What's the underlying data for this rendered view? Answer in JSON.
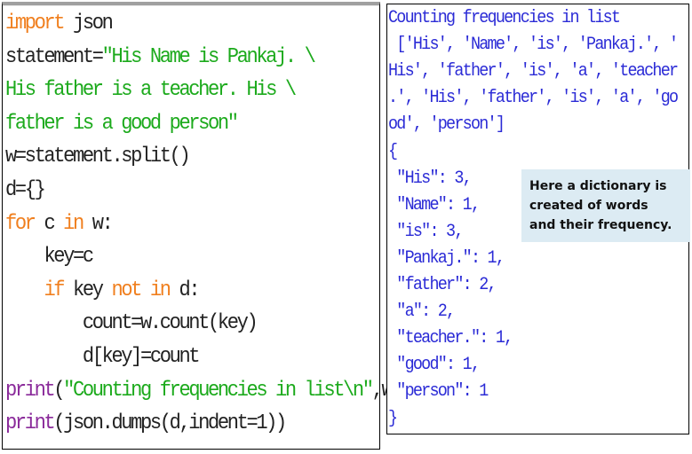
{
  "code_editor": {
    "language": "python",
    "lines": [
      {
        "indent": "",
        "tokens": [
          {
            "t": "import",
            "k": "kw"
          },
          {
            "t": " json",
            "k": "plain"
          }
        ]
      },
      {
        "indent": "",
        "tokens": [
          {
            "t": "statement=",
            "k": "plain"
          },
          {
            "t": "\"His Name is Pankaj. \\",
            "k": "str"
          }
        ]
      },
      {
        "indent": "",
        "tokens": [
          {
            "t": "His father is a teacher. His \\",
            "k": "str"
          }
        ]
      },
      {
        "indent": "",
        "tokens": [
          {
            "t": "father is a good person\"",
            "k": "str"
          }
        ]
      },
      {
        "indent": "",
        "tokens": [
          {
            "t": "w=statement.split()",
            "k": "plain"
          }
        ]
      },
      {
        "indent": "",
        "tokens": [
          {
            "t": "d={}",
            "k": "plain"
          }
        ]
      },
      {
        "indent": "",
        "tokens": [
          {
            "t": "for",
            "k": "kw"
          },
          {
            "t": " c ",
            "k": "plain"
          },
          {
            "t": "in",
            "k": "kw"
          },
          {
            "t": " w:",
            "k": "plain"
          }
        ]
      },
      {
        "indent": "    ",
        "tokens": [
          {
            "t": "key=c",
            "k": "plain"
          }
        ]
      },
      {
        "indent": "    ",
        "tokens": [
          {
            "t": "if",
            "k": "kw"
          },
          {
            "t": " key ",
            "k": "plain"
          },
          {
            "t": "not in",
            "k": "kw"
          },
          {
            "t": " d:",
            "k": "plain"
          }
        ]
      },
      {
        "indent": "        ",
        "tokens": [
          {
            "t": "count=w.count(key)",
            "k": "plain"
          }
        ]
      },
      {
        "indent": "        ",
        "tokens": [
          {
            "t": "d[key]=count",
            "k": "plain"
          }
        ]
      },
      {
        "indent": "",
        "tokens": [
          {
            "t": "print",
            "k": "bi"
          },
          {
            "t": "(",
            "k": "plain"
          },
          {
            "t": "\"Counting frequencies in list\\n\"",
            "k": "str"
          },
          {
            "t": ",w)",
            "k": "plain"
          }
        ]
      },
      {
        "indent": "",
        "tokens": [
          {
            "t": "print",
            "k": "bi"
          },
          {
            "t": "(json.dumps(d,indent=1))",
            "k": "plain"
          }
        ]
      }
    ]
  },
  "output_console": {
    "lines": [
      "Counting frequencies in list",
      " ['His', 'Name', 'is', 'Pankaj.', '",
      "His', 'father', 'is', 'a', 'teacher",
      ".', 'His', 'father', 'is', 'a', 'go",
      "od', 'person']",
      "{",
      " \"His\": 3,",
      " \"Name\": 1,",
      " \"is\": 3,",
      " \"Pankaj.\": 1,",
      " \"father\": 2,",
      " \"a\": 2,",
      " \"teacher.\": 1,",
      " \"good\": 1,",
      " \"person\": 1",
      "}"
    ]
  },
  "callout": {
    "lines": [
      "Here a dictionary is",
      "created of words",
      "and their frequency."
    ]
  },
  "colors": {
    "keyword": "#f07f1e",
    "string": "#1caa1c",
    "builtin": "#8a2a9a",
    "output_text": "#2b2bd6",
    "callout_bg": "#dcebf3"
  }
}
